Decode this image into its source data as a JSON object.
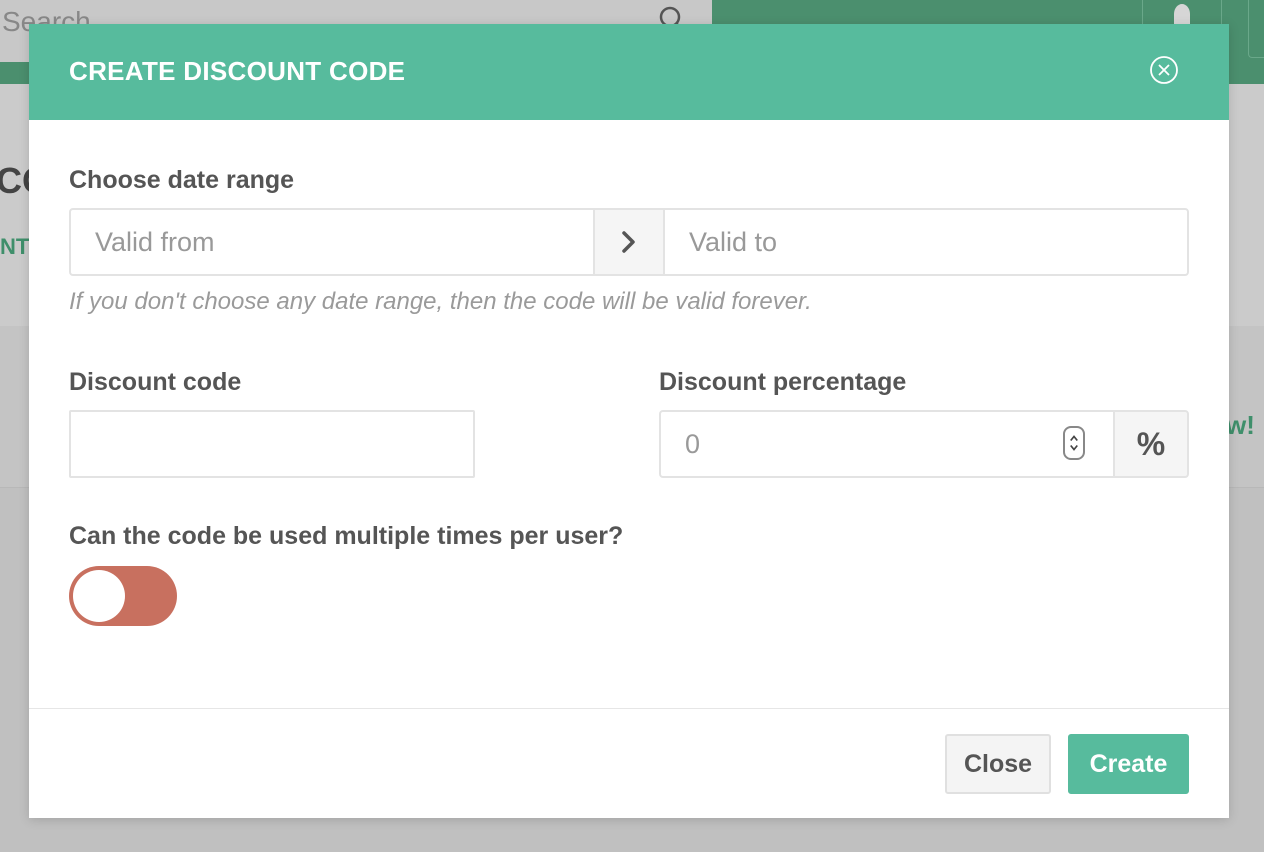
{
  "background": {
    "search_placeholder": "Search",
    "heading_fragment": "CO",
    "tab_fragment": "NT",
    "cta_fragment": "w!"
  },
  "modal": {
    "title": "CREATE DISCOUNT CODE",
    "date_range": {
      "label": "Choose date range",
      "from_placeholder": "Valid from",
      "to_placeholder": "Valid to",
      "hint": "If you don't choose any date range, then the code will be valid forever."
    },
    "discount_code": {
      "label": "Discount code",
      "value": ""
    },
    "discount_percentage": {
      "label": "Discount percentage",
      "placeholder": "0",
      "unit": "%"
    },
    "multiple_use": {
      "label": "Can the code be used multiple times per user?",
      "enabled": false
    },
    "buttons": {
      "close": "Close",
      "create": "Create"
    }
  },
  "colors": {
    "accent": "#57bb9d",
    "toggle_off": "#c8705f",
    "overlay_green": "#4b8f6e"
  },
  "icons": {
    "search": "search-icon",
    "bell": "bell-icon",
    "close": "close-circle-icon",
    "arrow": "chevron-right-icon",
    "spinner": "number-spinner-icon"
  }
}
